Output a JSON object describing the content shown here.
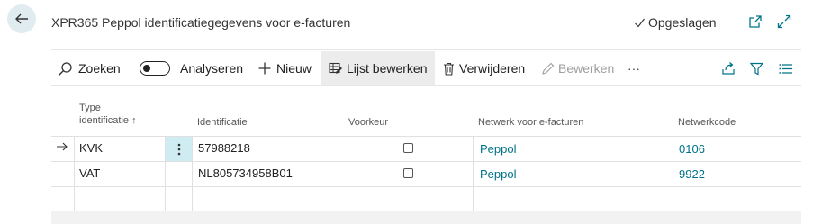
{
  "header": {
    "title": "XPR365 Peppol identificatiegegevens voor e-facturen",
    "save_status": "Opgeslagen"
  },
  "toolbar": {
    "search": "Zoeken",
    "analyze": "Analyseren",
    "analyze_on": false,
    "new": "Nieuw",
    "edit_list": "Lijst bewerken",
    "delete": "Verwijderen",
    "edit": "Bewerken",
    "more": "···"
  },
  "table": {
    "columns": {
      "type_line1": "Type",
      "type_line2": "identificatie ↑",
      "identification": "Identificatie",
      "preference": "Voorkeur",
      "network": "Netwerk voor e-facturen",
      "network_code": "Netwerkcode"
    },
    "rows": [
      {
        "type": "KVK",
        "identification": "57988218",
        "preference": false,
        "network": "Peppol",
        "network_code": "0106"
      },
      {
        "type": "VAT",
        "identification": "NL805734958B01",
        "preference": false,
        "network": "Peppol",
        "network_code": "9922"
      }
    ]
  },
  "colors": {
    "accent": "#00738a",
    "back_button_bg": "#e1ecf1",
    "selected_cell": "#cfecf3"
  }
}
